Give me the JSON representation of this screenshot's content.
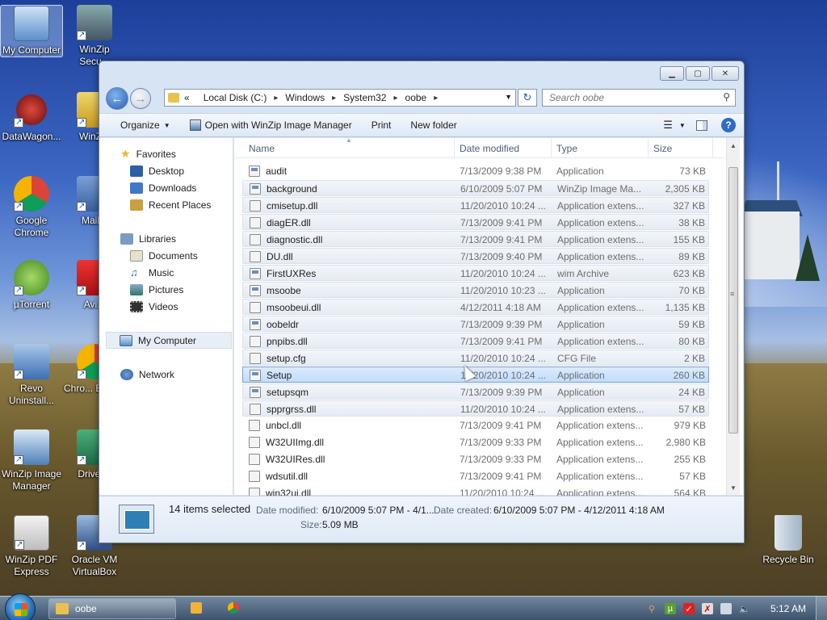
{
  "desktop": {
    "icons": [
      {
        "label": "My Computer"
      },
      {
        "label": "WinZip Secu..."
      },
      {
        "label": "DataWagon..."
      },
      {
        "label": "WinZ..."
      },
      {
        "label": "Google Chrome"
      },
      {
        "label": "Mail..."
      },
      {
        "label": "µTorrent"
      },
      {
        "label": "Avi..."
      },
      {
        "label": "Revo Uninstall..."
      },
      {
        "label": "Chro... Brow..."
      },
      {
        "label": "WinZip Image Manager"
      },
      {
        "label": "Driver..."
      },
      {
        "label": "WinZip PDF Express"
      },
      {
        "label": "Oracle VM VirtualBox"
      },
      {
        "label": "Recycle Bin"
      }
    ]
  },
  "address": {
    "crumbs": [
      "«",
      "Local Disk (C:)",
      "Windows",
      "System32",
      "oobe"
    ],
    "search_placeholder": "Search oobe"
  },
  "toolbar": {
    "organize": "Organize",
    "open_with": "Open with WinZip Image Manager",
    "print": "Print",
    "new_folder": "New folder"
  },
  "nav": {
    "favorites": "Favorites",
    "desktop": "Desktop",
    "downloads": "Downloads",
    "recent": "Recent Places",
    "libraries": "Libraries",
    "documents": "Documents",
    "music": "Music",
    "pictures": "Pictures",
    "videos": "Videos",
    "computer": "My Computer",
    "network": "Network"
  },
  "columns": {
    "name": "Name",
    "date": "Date modified",
    "type": "Type",
    "size": "Size"
  },
  "files": [
    {
      "name": "audit",
      "date": "7/13/2009 9:38 PM",
      "type": "Application",
      "size": "73 KB",
      "state": "none"
    },
    {
      "name": "background",
      "date": "6/10/2009 5:07 PM",
      "type": "WinZip Image Ma...",
      "size": "2,305 KB",
      "state": "sel"
    },
    {
      "name": "cmisetup.dll",
      "date": "11/20/2010 10:24 ...",
      "type": "Application extens...",
      "size": "327 KB",
      "state": "sel"
    },
    {
      "name": "diagER.dll",
      "date": "7/13/2009 9:41 PM",
      "type": "Application extens...",
      "size": "38 KB",
      "state": "sel"
    },
    {
      "name": "diagnostic.dll",
      "date": "7/13/2009 9:41 PM",
      "type": "Application extens...",
      "size": "155 KB",
      "state": "sel"
    },
    {
      "name": "DU.dll",
      "date": "7/13/2009 9:40 PM",
      "type": "Application extens...",
      "size": "89 KB",
      "state": "sel"
    },
    {
      "name": "FirstUXRes",
      "date": "11/20/2010 10:24 ...",
      "type": "wim Archive",
      "size": "623 KB",
      "state": "sel"
    },
    {
      "name": "msoobe",
      "date": "11/20/2010 10:23 ...",
      "type": "Application",
      "size": "70 KB",
      "state": "sel"
    },
    {
      "name": "msoobeui.dll",
      "date": "4/12/2011 4:18 AM",
      "type": "Application extens...",
      "size": "1,135 KB",
      "state": "sel"
    },
    {
      "name": "oobeldr",
      "date": "7/13/2009 9:39 PM",
      "type": "Application",
      "size": "59 KB",
      "state": "sel"
    },
    {
      "name": "pnpibs.dll",
      "date": "7/13/2009 9:41 PM",
      "type": "Application extens...",
      "size": "80 KB",
      "state": "sel"
    },
    {
      "name": "setup.cfg",
      "date": "11/20/2010 10:24 ...",
      "type": "CFG File",
      "size": "2 KB",
      "state": "sel"
    },
    {
      "name": "Setup",
      "date": "11/20/2010 10:24 ...",
      "type": "Application",
      "size": "260 KB",
      "state": "focus"
    },
    {
      "name": "setupsqm",
      "date": "7/13/2009 9:39 PM",
      "type": "Application",
      "size": "24 KB",
      "state": "sel"
    },
    {
      "name": "spprgrss.dll",
      "date": "11/20/2010 10:24 ...",
      "type": "Application extens...",
      "size": "57 KB",
      "state": "sel"
    },
    {
      "name": "unbcl.dll",
      "date": "7/13/2009 9:41 PM",
      "type": "Application extens...",
      "size": "979 KB",
      "state": "none"
    },
    {
      "name": "W32UIImg.dll",
      "date": "7/13/2009 9:33 PM",
      "type": "Application extens...",
      "size": "2,980 KB",
      "state": "none"
    },
    {
      "name": "W32UIRes.dll",
      "date": "7/13/2009 9:33 PM",
      "type": "Application extens...",
      "size": "255 KB",
      "state": "none"
    },
    {
      "name": "wdsutil.dll",
      "date": "7/13/2009 9:41 PM",
      "type": "Application extens...",
      "size": "57 KB",
      "state": "none"
    },
    {
      "name": "win32ui.dll",
      "date": "11/20/2010 10:24 ...",
      "type": "Application extens...",
      "size": "564 KB",
      "state": "none"
    }
  ],
  "details": {
    "selected": "14 items selected",
    "date_modified_label": "Date modified:",
    "date_modified": "6/10/2009 5:07 PM - 4/1...",
    "date_created_label": "Date created:",
    "date_created": "6/10/2009 5:07 PM - 4/12/2011 4:18 AM",
    "size_label": "Size:",
    "size": "5.09 MB"
  },
  "taskbar": {
    "window_label": "oobe",
    "clock": "5:12 AM"
  }
}
